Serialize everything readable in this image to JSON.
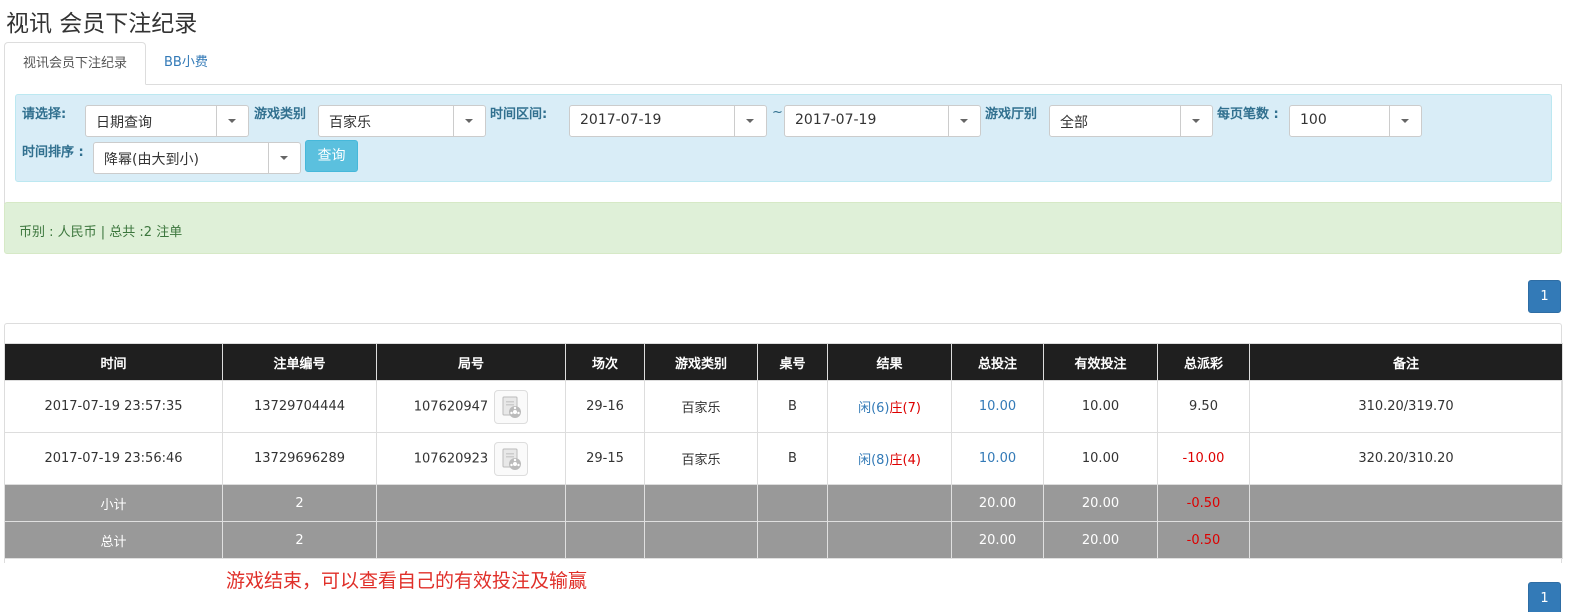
{
  "page": {
    "title": "视讯 会员下注纪录"
  },
  "tabs": [
    {
      "label": "视讯会员下注纪录",
      "active": true
    },
    {
      "label": "BB小费",
      "active": false
    }
  ],
  "filters": {
    "select_label": "请选择:",
    "select_value": "日期查询",
    "game_type_label": "游戏类别",
    "game_type_value": "百家乐",
    "time_range_label": "时间区间:",
    "date_from": "2017-07-19",
    "range_sep": "~",
    "date_to": "2017-07-19",
    "hall_label": "游戏厅别",
    "hall_value": "全部",
    "per_page_label": "每页笔数 :",
    "per_page_value": "100",
    "sort_label": "时间排序 :",
    "sort_value": "降幂(由大到小)",
    "query_button": "查询"
  },
  "summary": {
    "text": "币别 : 人民币 | 总共 :2 注单"
  },
  "pagination": {
    "current": "1"
  },
  "table": {
    "headers": [
      "时间",
      "注单编号",
      "局号",
      "场次",
      "游戏类别",
      "桌号",
      "结果",
      "总投注",
      "有效投注",
      "总派彩",
      "备注"
    ],
    "rows": [
      {
        "time": "2017-07-19 23:57:35",
        "bet_id": "13729704444",
        "round_id": "107620947",
        "session": "29-16",
        "game_type": "百家乐",
        "table": "B",
        "result_xian": "闲(6)",
        "result_zhuang": "庄(7)",
        "total_bet": "10.00",
        "valid_bet": "10.00",
        "payout": "9.50",
        "remark": "310.20/319.70"
      },
      {
        "time": "2017-07-19 23:56:46",
        "bet_id": "13729696289",
        "round_id": "107620923",
        "session": "29-15",
        "game_type": "百家乐",
        "table": "B",
        "result_xian": "闲(8)",
        "result_zhuang": "庄(4)",
        "total_bet": "10.00",
        "valid_bet": "10.00",
        "payout": "-10.00",
        "remark": "320.20/310.20"
      }
    ],
    "subtotal": {
      "label": "小计",
      "count": "2",
      "total_bet": "20.00",
      "valid_bet": "20.00",
      "payout": "-0.50"
    },
    "grand_total": {
      "label": "总计",
      "count": "2",
      "total_bet": "20.00",
      "valid_bet": "20.00",
      "payout": "-0.50"
    }
  },
  "note": {
    "text": "游戏结束，可以查看自己的有效投注及输赢"
  },
  "icons": {
    "video": "video-film-icon",
    "dropdown": "chevron-down-icon"
  },
  "colors": {
    "accent": "#337ab7",
    "info_bg": "#d9edf7",
    "success_bg": "#dff0d8",
    "negative": "#dd0000",
    "header_bg": "#1f1f1f",
    "subtotal_bg": "#999999"
  }
}
